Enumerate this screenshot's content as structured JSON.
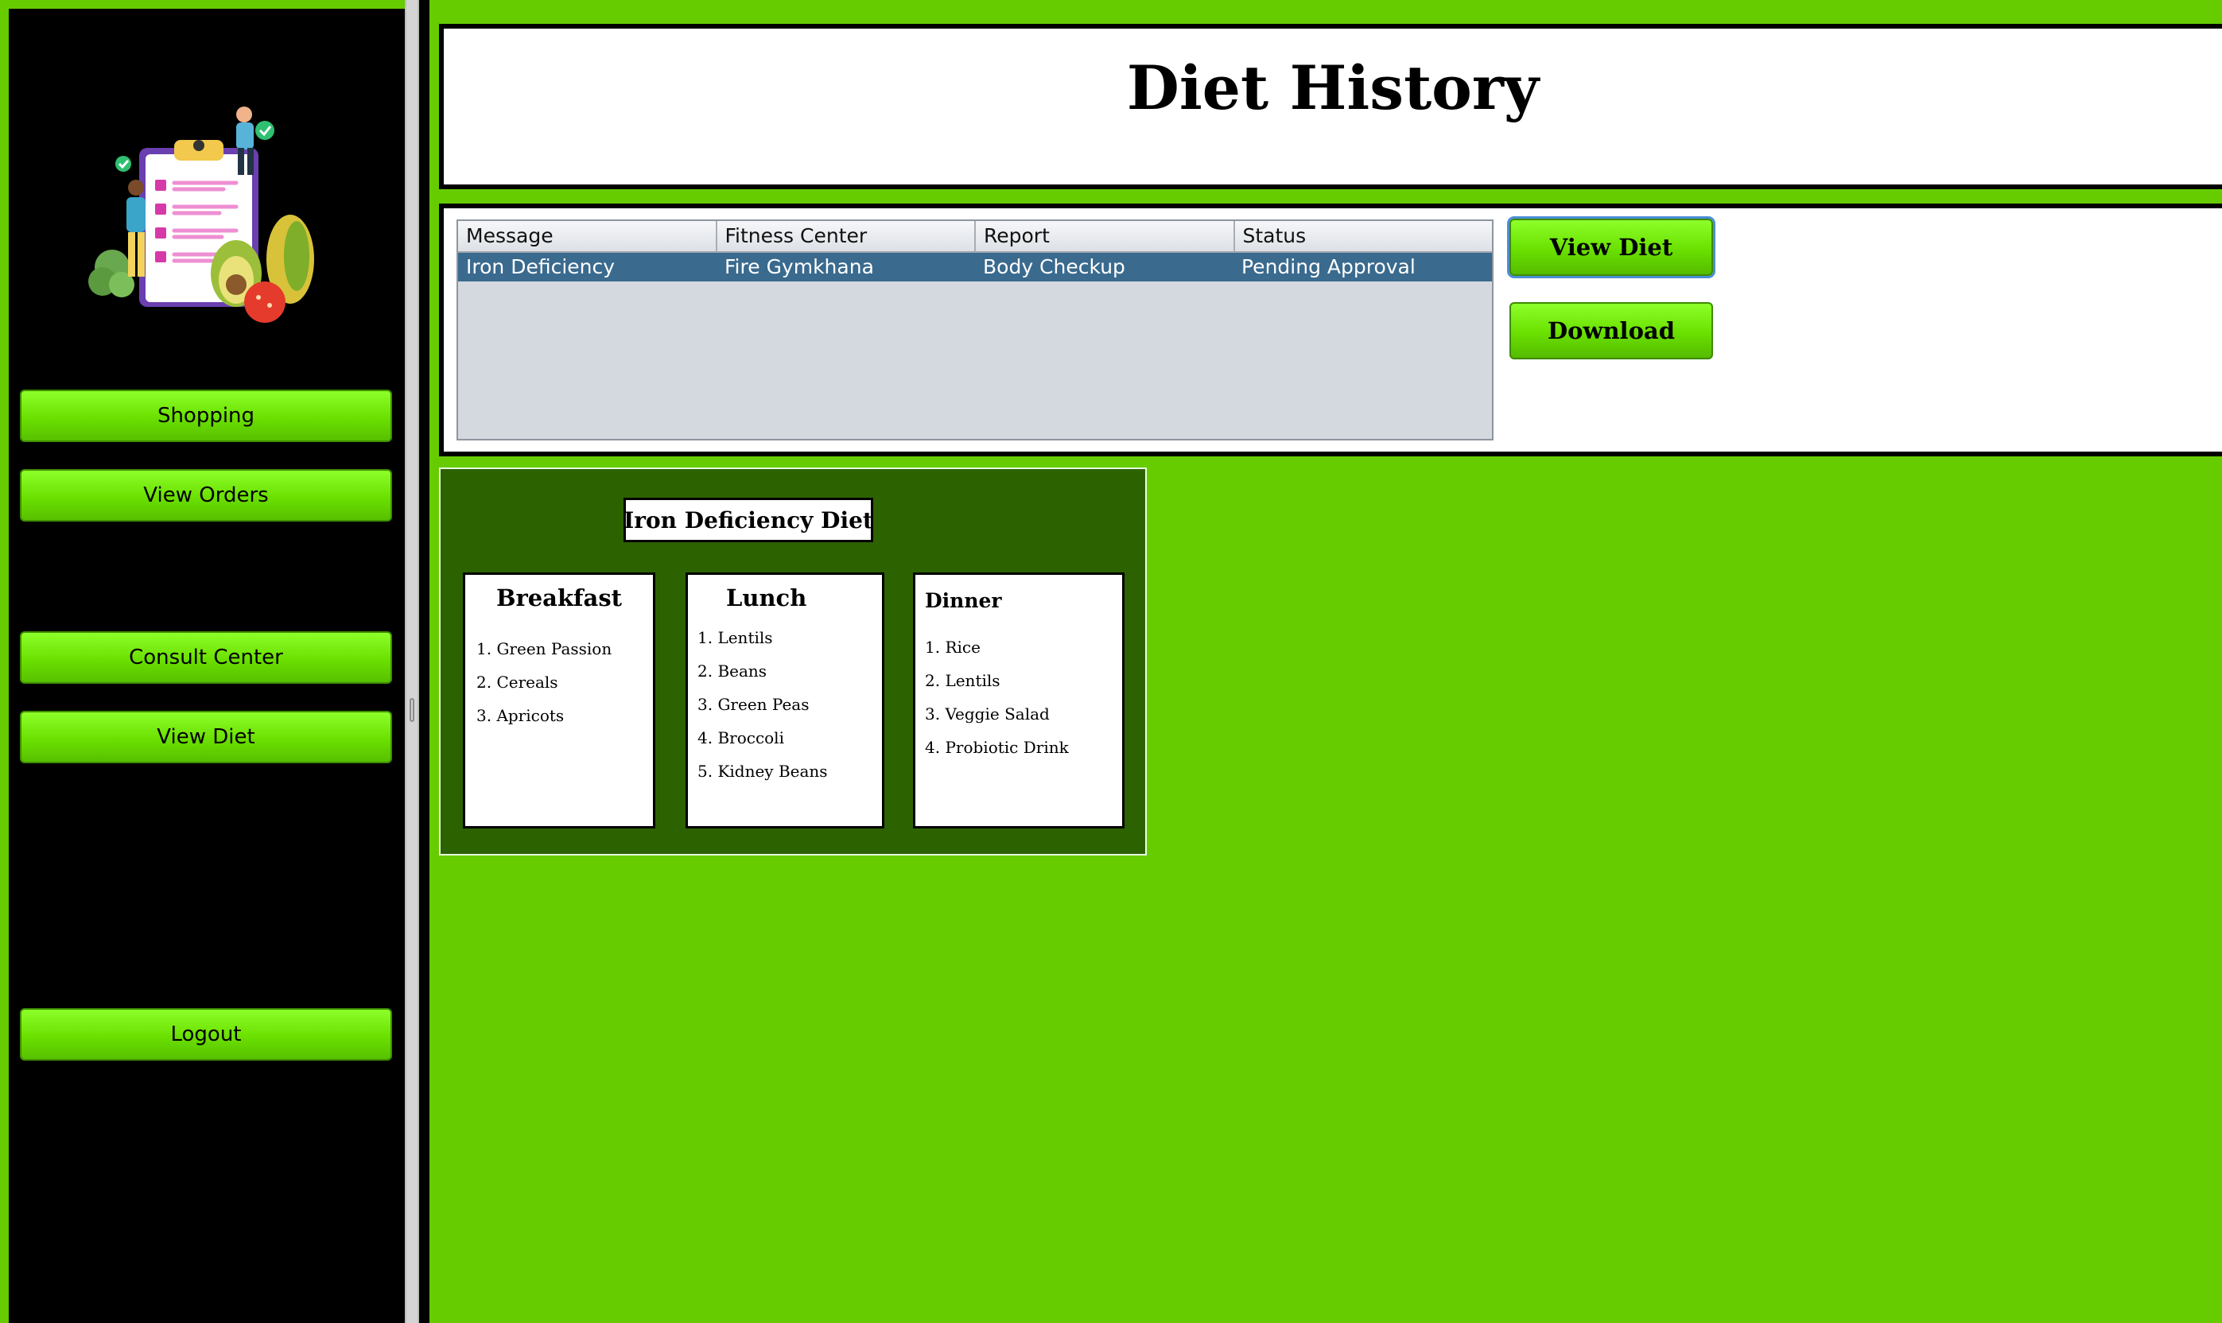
{
  "sidebar": {
    "buttons": {
      "shopping": "Shopping",
      "view_orders": "View Orders",
      "consult_center": "Consult Center",
      "view_diet": "View Diet",
      "logout": "Logout"
    }
  },
  "header": {
    "title": "Diet History"
  },
  "table": {
    "columns": [
      "Message",
      "Fitness Center",
      "Report",
      "Status"
    ],
    "rows": [
      [
        "Iron Deficiency",
        "Fire Gymkhana",
        "Body Checkup",
        "Pending Approval"
      ]
    ]
  },
  "actions": {
    "view_diet": "View Diet",
    "download": "Download"
  },
  "diet": {
    "title": "Iron Deficiency Diet",
    "breakfast": {
      "title": "Breakfast",
      "items": [
        "1. Green Passion",
        "2. Cereals",
        "3. Apricots"
      ]
    },
    "lunch": {
      "title": "Lunch",
      "items": [
        "1. Lentils",
        "2. Beans",
        "3. Green Peas",
        "4. Broccoli",
        "5. Kidney Beans"
      ]
    },
    "dinner": {
      "title": "Dinner",
      "items": [
        "1. Rice",
        "2. Lentils",
        "3. Veggie Salad",
        "4. Probiotic Drink"
      ]
    }
  },
  "colors": {
    "accent_green": "#66cc00",
    "selected_row": "#3a6a8e",
    "sidebar_bg": "#000000",
    "diet_card_bg": "#2d6200"
  },
  "icons": {
    "logo": "diet-checklist-illustration"
  }
}
